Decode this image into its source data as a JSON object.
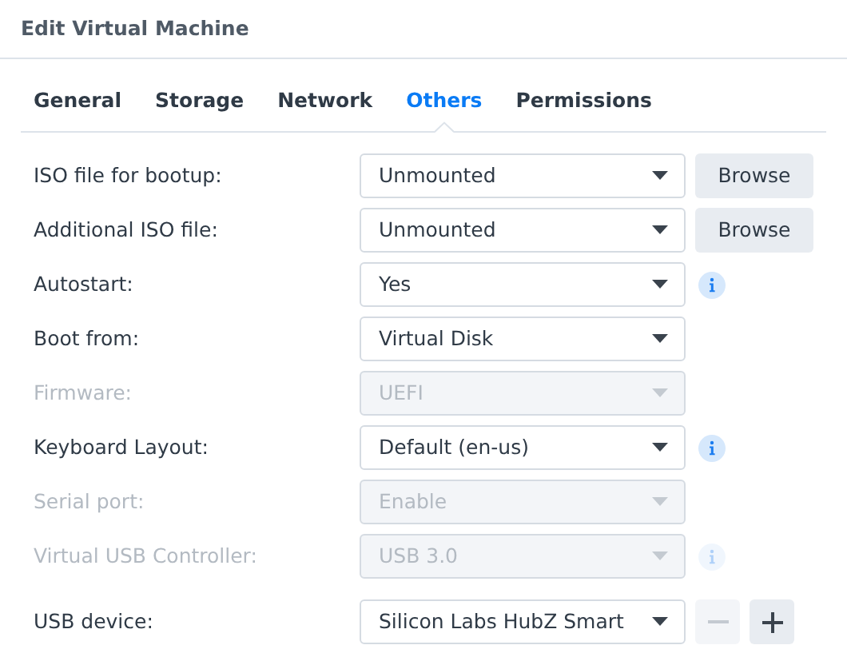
{
  "window": {
    "title": "Edit Virtual Machine"
  },
  "tabs": [
    {
      "label": "General",
      "selected": false
    },
    {
      "label": "Storage",
      "selected": false
    },
    {
      "label": "Network",
      "selected": false
    },
    {
      "label": "Others",
      "selected": true
    },
    {
      "label": "Permissions",
      "selected": false
    }
  ],
  "rows": [
    {
      "label": "ISO file for bootup:",
      "value": "Unmounted",
      "disabled": false,
      "trailing": {
        "kind": "button",
        "label": "Browse"
      }
    },
    {
      "label": "Additional ISO file:",
      "value": "Unmounted",
      "disabled": false,
      "trailing": {
        "kind": "button",
        "label": "Browse"
      }
    },
    {
      "label": "Autostart:",
      "value": "Yes",
      "disabled": false,
      "trailing": {
        "kind": "info"
      }
    },
    {
      "label": "Boot from:",
      "value": "Virtual Disk",
      "disabled": false
    },
    {
      "label": "Firmware:",
      "value": "UEFI",
      "disabled": true
    },
    {
      "label": "Keyboard Layout:",
      "value": "Default (en-us)",
      "disabled": false,
      "trailing": {
        "kind": "info"
      }
    },
    {
      "label": "Serial port:",
      "value": "Enable",
      "disabled": true
    },
    {
      "label": "Virtual USB Controller:",
      "value": "USB 3.0",
      "disabled": true,
      "trailing": {
        "kind": "info"
      }
    },
    {
      "label": "USB device:",
      "value": "Silicon Labs HubZ Smart",
      "disabled": false,
      "trailing": {
        "kind": "add_remove",
        "remove_disabled": true
      }
    }
  ]
}
